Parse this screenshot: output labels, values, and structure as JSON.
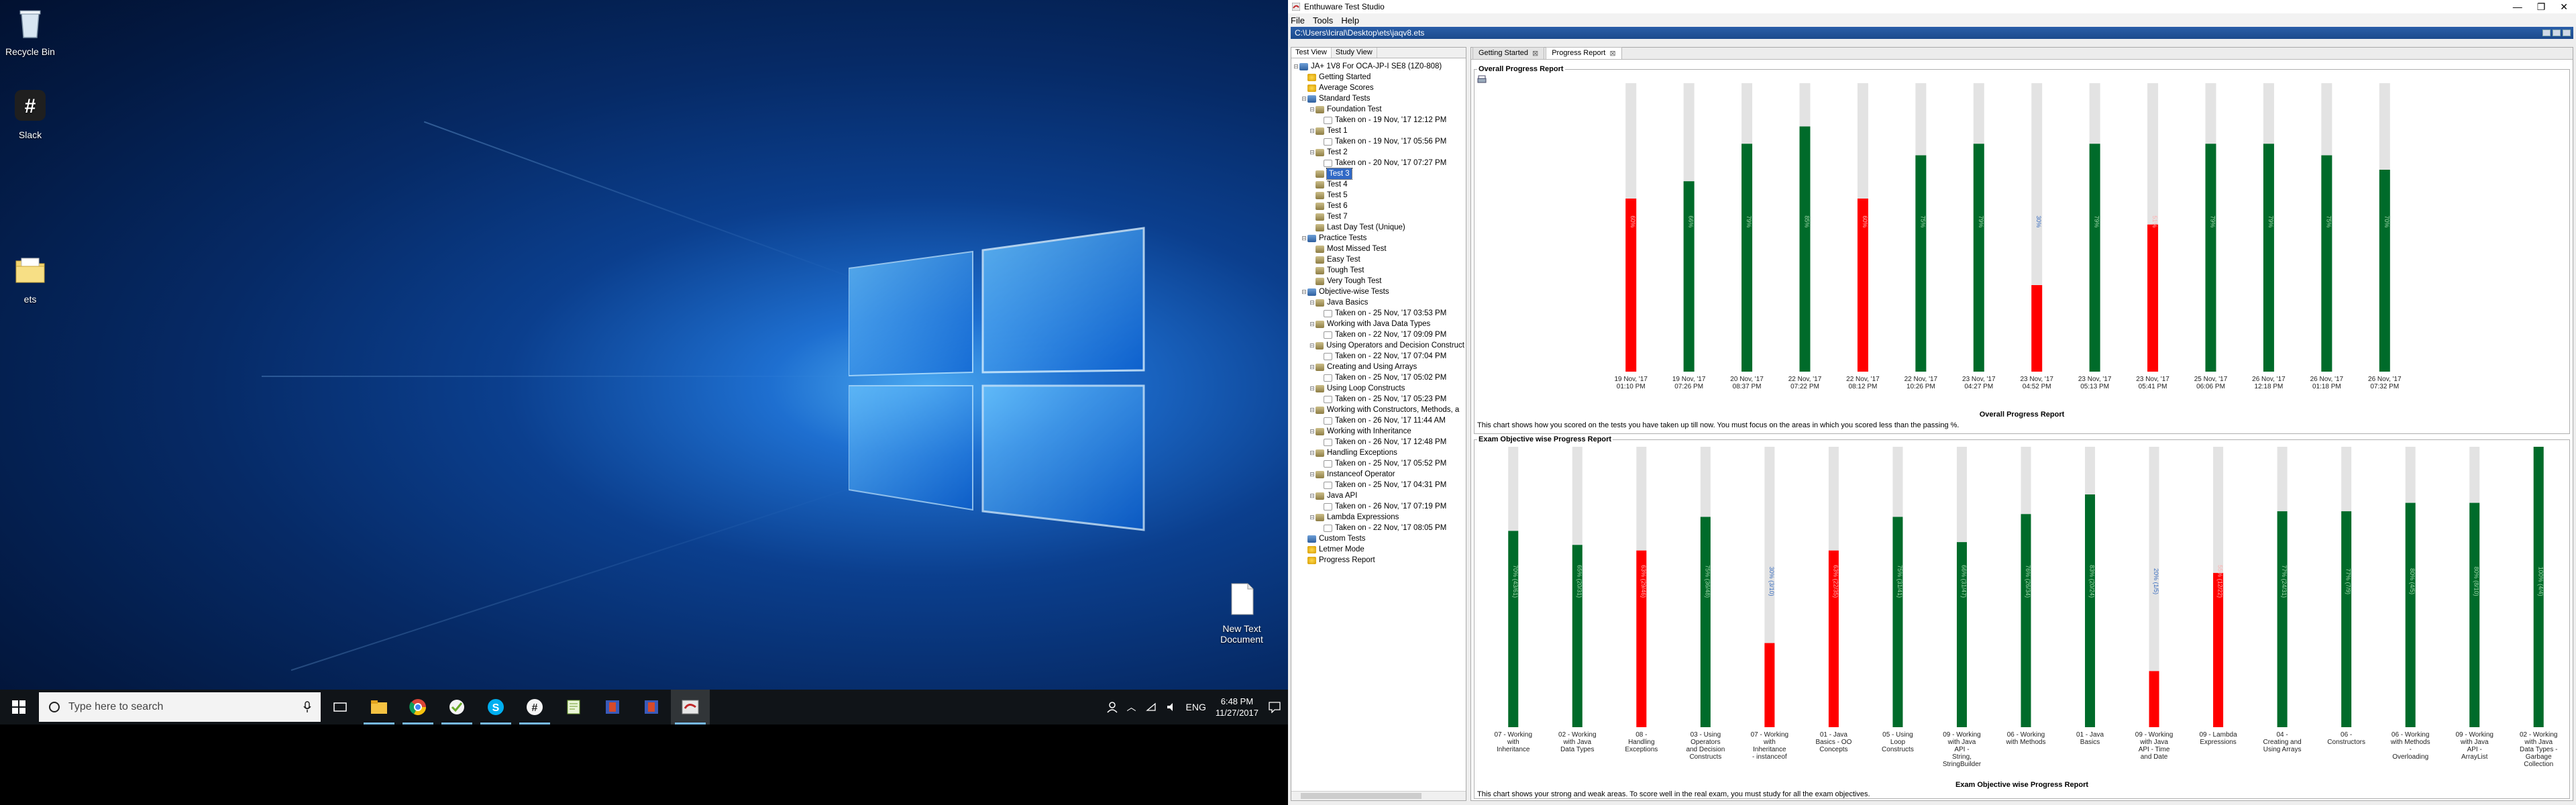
{
  "desktop": {
    "icons": [
      {
        "name": "recycle-bin-icon",
        "label": "Recycle Bin"
      },
      {
        "name": "slack-desktop-icon",
        "label": "Slack"
      },
      {
        "name": "ets-folder-icon",
        "label": "ets"
      },
      {
        "name": "new-text-document-icon",
        "label": "New Text Document"
      }
    ]
  },
  "taskbar": {
    "search_placeholder": "Type here to search",
    "language": "ENG",
    "time": "6:48 PM",
    "date": "11/27/2017"
  },
  "app": {
    "title": "Enthuware Test Studio",
    "menu": [
      "File",
      "Tools",
      "Help"
    ],
    "path": "C:\\Users\\Iciral\\Desktop\\ets\\jaqv8.ets",
    "left_tabs": [
      "Test View",
      "Study View"
    ],
    "doc_tabs": [
      "Getting Started",
      "Progress Report"
    ],
    "tree": [
      {
        "level": 0,
        "icon": "book",
        "label": "JA+ 1V8 For OCA-JP-I SE8 (1Z0-808)",
        "exp": "−"
      },
      {
        "level": 1,
        "icon": "star",
        "label": "Getting Started"
      },
      {
        "level": 1,
        "icon": "star",
        "label": "Average Scores"
      },
      {
        "level": 1,
        "icon": "book",
        "label": "Standard Tests",
        "exp": "−"
      },
      {
        "level": 2,
        "icon": "folder",
        "label": "Foundation Test",
        "exp": "−"
      },
      {
        "level": 3,
        "icon": "doc",
        "label": "Taken on - 19 Nov, '17 12:12 PM"
      },
      {
        "level": 2,
        "icon": "folder",
        "label": "Test 1",
        "exp": "−"
      },
      {
        "level": 3,
        "icon": "doc",
        "label": "Taken on - 19 Nov, '17 05:56 PM"
      },
      {
        "level": 2,
        "icon": "folder",
        "label": "Test 2",
        "exp": "−"
      },
      {
        "level": 3,
        "icon": "doc",
        "label": "Taken on - 20 Nov, '17 07:27 PM"
      },
      {
        "level": 2,
        "icon": "folder",
        "label": "Test 3",
        "selected": true
      },
      {
        "level": 2,
        "icon": "folder",
        "label": "Test 4"
      },
      {
        "level": 2,
        "icon": "folder",
        "label": "Test 5"
      },
      {
        "level": 2,
        "icon": "folder",
        "label": "Test 6"
      },
      {
        "level": 2,
        "icon": "folder",
        "label": "Test 7"
      },
      {
        "level": 2,
        "icon": "folder",
        "label": "Last Day Test (Unique)"
      },
      {
        "level": 1,
        "icon": "book",
        "label": "Practice Tests",
        "exp": "−"
      },
      {
        "level": 2,
        "icon": "folder",
        "label": "Most Missed Test"
      },
      {
        "level": 2,
        "icon": "folder",
        "label": "Easy Test"
      },
      {
        "level": 2,
        "icon": "folder",
        "label": "Tough Test"
      },
      {
        "level": 2,
        "icon": "folder",
        "label": "Very Tough Test"
      },
      {
        "level": 1,
        "icon": "book",
        "label": "Objective-wise Tests",
        "exp": "−"
      },
      {
        "level": 2,
        "icon": "folder",
        "label": "Java Basics",
        "exp": "−"
      },
      {
        "level": 3,
        "icon": "doc",
        "label": "Taken on - 25 Nov, '17 03:53 PM"
      },
      {
        "level": 2,
        "icon": "folder",
        "label": "Working with Java Data Types",
        "exp": "−"
      },
      {
        "level": 3,
        "icon": "doc",
        "label": "Taken on - 22 Nov, '17 09:09 PM"
      },
      {
        "level": 2,
        "icon": "folder",
        "label": "Using Operators and Decision Construct",
        "exp": "−"
      },
      {
        "level": 3,
        "icon": "doc",
        "label": "Taken on - 22 Nov, '17 07:04 PM"
      },
      {
        "level": 2,
        "icon": "folder",
        "label": "Creating and Using Arrays",
        "exp": "−"
      },
      {
        "level": 3,
        "icon": "doc",
        "label": "Taken on - 25 Nov, '17 05:02 PM"
      },
      {
        "level": 2,
        "icon": "folder",
        "label": "Using Loop Constructs",
        "exp": "−"
      },
      {
        "level": 3,
        "icon": "doc",
        "label": "Taken on - 25 Nov, '17 05:23 PM"
      },
      {
        "level": 2,
        "icon": "folder",
        "label": "Working with Constructors, Methods, a",
        "exp": "−"
      },
      {
        "level": 3,
        "icon": "doc",
        "label": "Taken on - 26 Nov, '17 11:44 AM"
      },
      {
        "level": 2,
        "icon": "folder",
        "label": "Working with Inheritance",
        "exp": "−"
      },
      {
        "level": 3,
        "icon": "doc",
        "label": "Taken on - 26 Nov, '17 12:48 PM"
      },
      {
        "level": 2,
        "icon": "folder",
        "label": "Handling Exceptions",
        "exp": "−"
      },
      {
        "level": 3,
        "icon": "doc",
        "label": "Taken on - 25 Nov, '17 05:52 PM"
      },
      {
        "level": 2,
        "icon": "folder",
        "label": "Instanceof Operator",
        "exp": "−"
      },
      {
        "level": 3,
        "icon": "doc",
        "label": "Taken on - 25 Nov, '17 04:31 PM"
      },
      {
        "level": 2,
        "icon": "folder",
        "label": "Java API",
        "exp": "−"
      },
      {
        "level": 3,
        "icon": "doc",
        "label": "Taken on - 26 Nov, '17 07:19 PM"
      },
      {
        "level": 2,
        "icon": "folder",
        "label": "Lambda Expressions",
        "exp": "−"
      },
      {
        "level": 3,
        "icon": "doc",
        "label": "Taken on - 22 Nov, '17 08:05 PM"
      },
      {
        "level": 1,
        "icon": "book",
        "label": "Custom Tests"
      },
      {
        "level": 1,
        "icon": "star",
        "label": "Letmer Mode"
      },
      {
        "level": 1,
        "icon": "star",
        "label": "Progress Report"
      }
    ],
    "overall_panel_title": "Overall Progress Report",
    "overall_caption": "Overall Progress Report",
    "overall_desc": "This chart shows how you scored on the tests you have taken up till now. You must focus on the areas in which you scored less than the passing %.",
    "objective_panel_title": "Exam Objective wise Progress Report",
    "objective_caption": "Exam Objective wise Progress Report",
    "objective_desc": "This chart shows your strong and weak areas. To score well in the real exam, you must study for all the exam objectives."
  },
  "chart_data": [
    {
      "type": "bar",
      "title": "Overall Progress Report",
      "categories": [
        "19 Nov, '17 01:10 PM",
        "19 Nov, '17 07:26 PM",
        "20 Nov, '17 08:37 PM",
        "22 Nov, '17 07:22 PM",
        "22 Nov, '17 08:12 PM",
        "22 Nov, '17 10:26 PM",
        "23 Nov, '17 04:27 PM",
        "23 Nov, '17 04:52 PM",
        "23 Nov, '17 05:13 PM",
        "23 Nov, '17 05:41 PM",
        "25 Nov, '17 06:06 PM",
        "26 Nov, '17 12:18 PM",
        "26 Nov, '17 01:18 PM",
        "26 Nov, '17 07:32 PM"
      ],
      "values": [
        60,
        66,
        79,
        85,
        60,
        75,
        79,
        30,
        79,
        51,
        79,
        79,
        75,
        70
      ],
      "value_labels": [
        "60%",
        "66%",
        "79%",
        "85%",
        "60%",
        "75%",
        "79%",
        "30%",
        "79%",
        "51%",
        "79%",
        "79%",
        "75%",
        "70%"
      ],
      "pass_mark": 65,
      "colors": {
        "pass": "#006b2a",
        "fail": "#ff0000",
        "track": "#e3e3e3"
      },
      "ylim": [
        0,
        100
      ]
    },
    {
      "type": "bar",
      "title": "Exam Objective wise Progress Report",
      "categories": [
        "07 - Working with Inheritance",
        "02 - Working with Java Data Types",
        "08 - Handling Exceptions",
        "03 - Using Operators and Decision Constructs",
        "07 - Working with Inheritance - instanceof",
        "01 - Java Basics - OO Concepts",
        "05 - Using Loop Constructs",
        "09 - Working with Java API - String, StringBuilder",
        "06 - Working with Methods",
        "01 - Java Basics",
        "09 - Working with Java API - Time and Date",
        "09 - Lambda Expressions",
        "04 - Creating and Using Arrays",
        "06 - Constructors",
        "06 - Working with Methods - Overloading",
        "09 - Working with Java API - ArrayList",
        "02 - Working with Java Data Types - Garbage Collection"
      ],
      "values": [
        70,
        65,
        63,
        75,
        30,
        63,
        75,
        66,
        76,
        83,
        20,
        55,
        77,
        77,
        80,
        80,
        100
      ],
      "value_labels": [
        "70% (43/61)",
        "65% (20/31)",
        "63% (29/46)",
        "75% (36/48)",
        "30% (3/10)",
        "63% (22/35)",
        "75% (31/41)",
        "66% (31/47)",
        "76% (26/34)",
        "83% (20/24)",
        "20% (1/5)",
        "55% (12/22)",
        "77% (24/31)",
        "77% (7/9)",
        "80% (4/5)",
        "80% (8/10)",
        "100% (4/4)"
      ],
      "pass_mark": 65,
      "ylim": [
        0,
        100
      ]
    }
  ]
}
